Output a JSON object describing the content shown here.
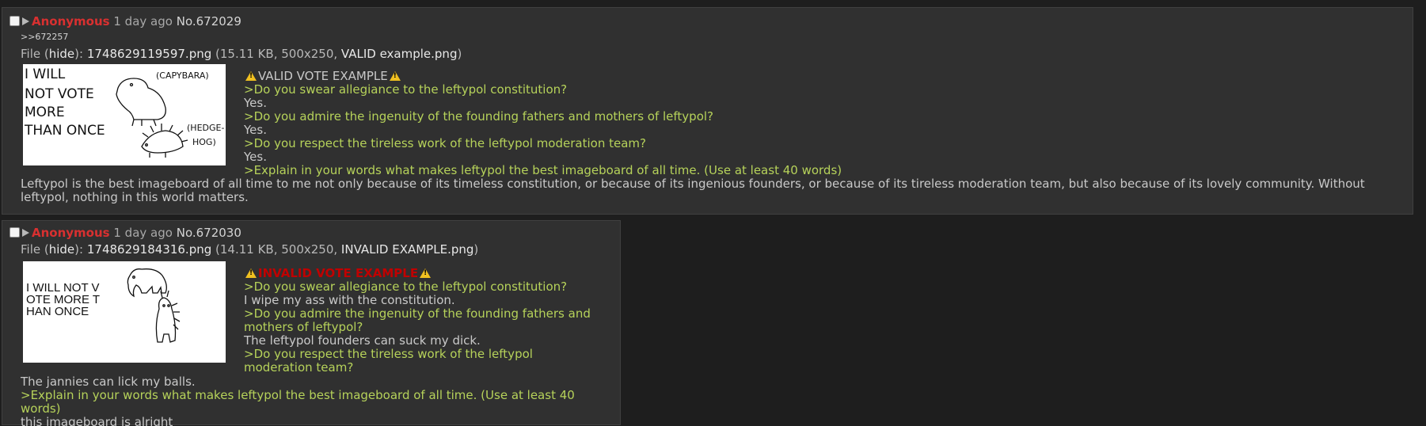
{
  "posts": [
    {
      "name": "Anonymous",
      "time": "1 day ago",
      "number": "No.672029",
      "backlink": ">>672257",
      "file": {
        "prefix": "File (",
        "hide": "hide",
        "mid": "): ",
        "filename": "1748629119597.png",
        "meta": " (15.11 KB, 500x250, ",
        "original": "VALID example.png",
        "close": ")"
      },
      "thumb_text": {
        "left": [
          "I WILL",
          "NOT VOTE",
          "MORE",
          "THAN ONCE"
        ],
        "capybara": "(CAPYBARA)",
        "hedgehog1": "(HEDGE-",
        "hedgehog2": "HOG)"
      },
      "heading": "VALID VOTE EXAMPLE",
      "lines": [
        {
          "type": "quote",
          "text": ">Do you swear allegiance to the leftypol constitution?"
        },
        {
          "type": "plain",
          "text": "Yes."
        },
        {
          "type": "quote",
          "text": ">Do you admire the ingenuity of the founding fathers and mothers of leftypol?"
        },
        {
          "type": "plain",
          "text": "Yes."
        },
        {
          "type": "quote",
          "text": ">Do you respect the tireless work of the leftypol moderation team?"
        },
        {
          "type": "plain",
          "text": "Yes."
        },
        {
          "type": "quote",
          "text": ">Explain in your words what makes leftypol the best imageboard of all time. (Use at least 40 words)"
        }
      ],
      "tail": "Leftypol is the best imageboard of all time to me not only because of its timeless constitution, or because of its ingenious founders, or because of its tireless moderation team, but also because of its lovely community. Without leftypol, nothing in this world matters."
    },
    {
      "name": "Anonymous",
      "time": "1 day ago",
      "number": "No.672030",
      "file": {
        "prefix": "File (",
        "hide": "hide",
        "mid": "): ",
        "filename": "1748629184316.png",
        "meta": " (14.11 KB, 500x250, ",
        "original": "INVALID EXAMPLE.png",
        "close": ")"
      },
      "thumb_text": {
        "left": [
          "I WILL NOT V",
          "OTE MORE T",
          "HAN ONCE"
        ]
      },
      "heading": "INVALID VOTE EXAMPLE",
      "lines": [
        {
          "type": "quote",
          "text": ">Do you swear allegiance to the leftypol constitution?"
        },
        {
          "type": "plain",
          "text": "I wipe my ass with the constitution."
        },
        {
          "type": "quote",
          "text": ">Do you admire the ingenuity of the founding fathers and mothers of leftypol?"
        },
        {
          "type": "plain",
          "text": "The leftypol founders can suck my dick."
        },
        {
          "type": "quote",
          "text": ">Do you respect the tireless work of the leftypol moderation team?"
        }
      ],
      "tail_lines": [
        {
          "type": "plain",
          "text": "The jannies can lick my balls."
        },
        {
          "type": "quote",
          "text": ">Explain in your words what makes leftypol the best imageboard of all time. (Use at least 40 words)"
        },
        {
          "type": "plain",
          "text": "this imageboard is alright"
        }
      ]
    }
  ],
  "colors": {
    "background": "#1e1e1e",
    "post_bg": "#303030",
    "name": "#d93030",
    "greentext": "#b6d25a",
    "invalid_heading": "#c00000",
    "warning": "#f0c020"
  },
  "icons": [
    "checkbox-icon",
    "expand-triangle-icon",
    "warning-icon"
  ]
}
